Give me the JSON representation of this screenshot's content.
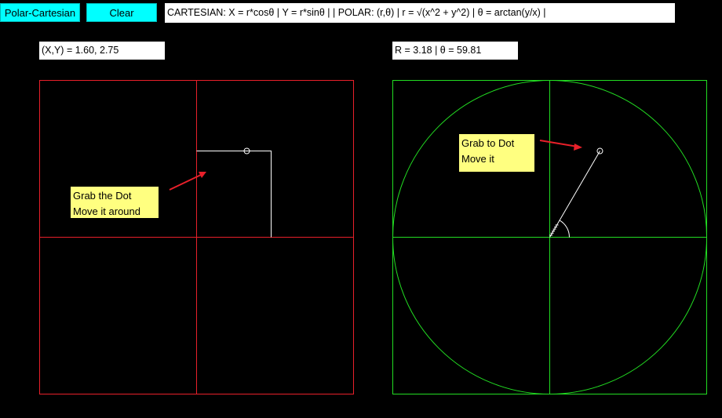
{
  "toolbar": {
    "polar_cartesian_label": "Polar-Cartesian",
    "clear_label": "Clear"
  },
  "formula_text": "CARTESIAN: X = r*cosθ  | Y = r*sinθ   | |   POLAR: (r,θ)  |   r = √(x^2 + y^2)  | θ = arctan(y/x)  |",
  "cartesian": {
    "readout": "(X,Y) = 1.60, 2.75",
    "x": 1.6,
    "y": 2.75,
    "axis_color": "#e8202a",
    "note_line1": "Grab the Dot",
    "note_line2": "Move it around"
  },
  "polar": {
    "readout": "R = 3.18  |  θ = 59.81",
    "r": 3.18,
    "theta_deg": 59.81,
    "axis_color": "#22dd22",
    "note_line1": "Grab to Dot",
    "note_line2": "Move it"
  },
  "colors": {
    "background": "#000000",
    "button": "#00ffff",
    "note": "#ffff80",
    "arrow": "#e8202a"
  }
}
